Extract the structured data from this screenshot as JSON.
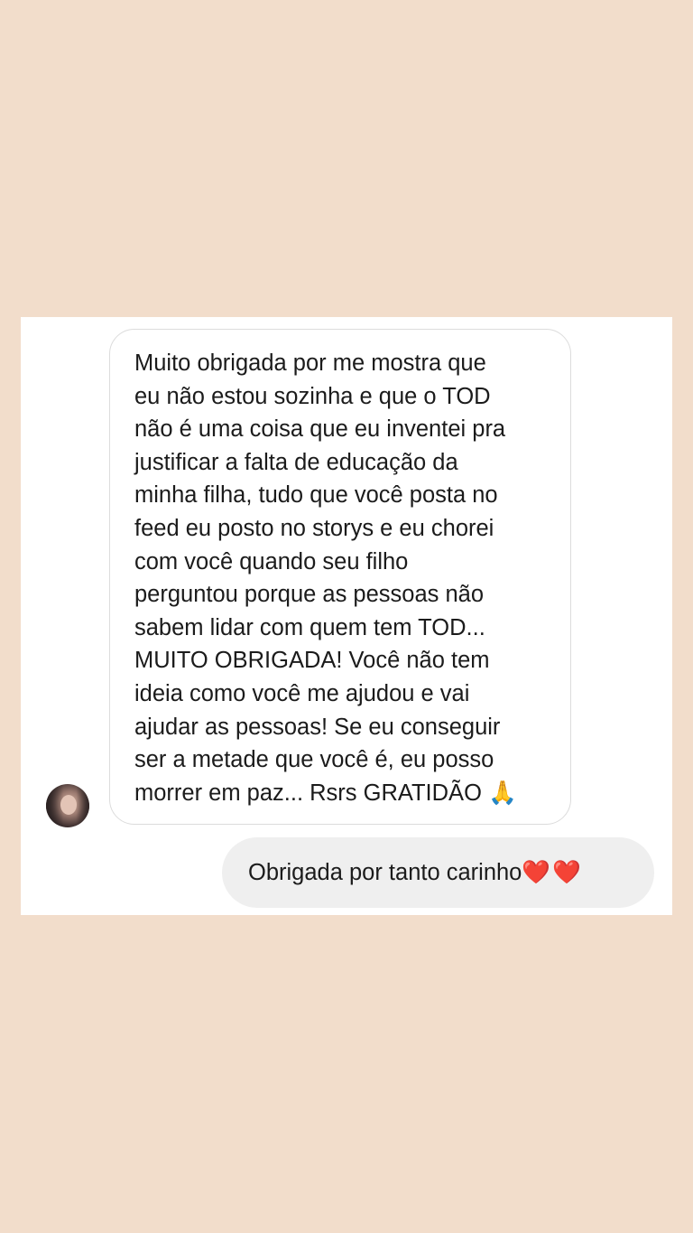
{
  "conversation": {
    "incoming_message": {
      "text": "Muito obrigada por me mostra que\neu não estou sozinha e que o TOD\nnão é uma coisa que eu inventei pra\njustificar a falta de  educação da\nminha filha, tudo que você posta no\nfeed eu posto no storys e eu chorei\ncom você quando seu filho\nperguntou porque as pessoas não\nsabem lidar com quem tem TOD...\nMUITO OBRIGADA! Você não tem\nideia como você me ajudou e vai\najudar as pessoas! Se eu conseguir\nser a metade que você é, eu posso\nmorrer em paz... Rsrs GRATIDÃO ",
      "emoji": "🙏"
    },
    "sender_avatar": "profile-photo",
    "outgoing_message": {
      "text": "Obrigada por tanto carinho",
      "emoji": "❤️❤️"
    }
  },
  "colors": {
    "background": "#f2ddcb",
    "card": "#ffffff",
    "incoming_border": "#dcdcdc",
    "outgoing_bubble": "#efefef",
    "text": "#1b1b1b"
  }
}
